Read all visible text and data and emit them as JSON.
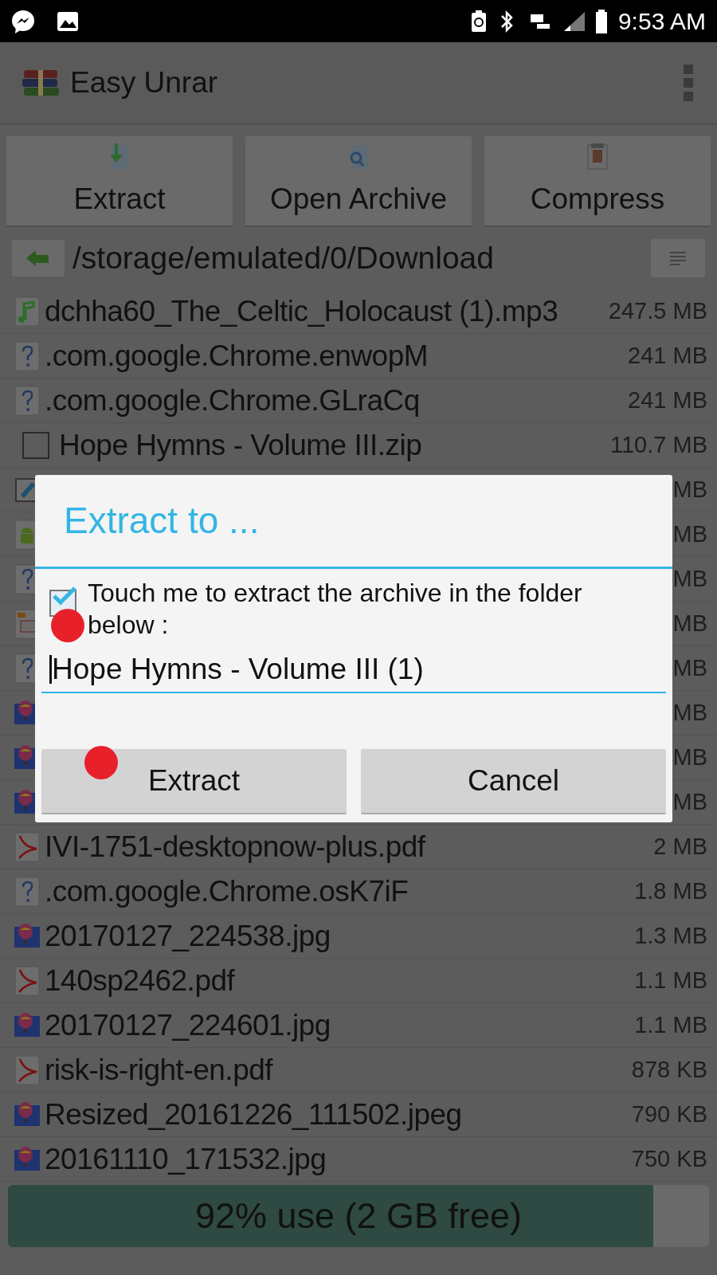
{
  "status_bar": {
    "time": "9:53 AM"
  },
  "app_bar": {
    "title": "Easy Unrar"
  },
  "toolbar": [
    {
      "label": "Extract",
      "kind": "extract"
    },
    {
      "label": "Open Archive",
      "kind": "open"
    },
    {
      "label": "Compress",
      "kind": "compress"
    }
  ],
  "path": "/storage/emulated/0/Download",
  "files": [
    {
      "kind": "audio",
      "name": "dchha60_The_Celtic_Holocaust (1).mp3",
      "size": "247.5 MB"
    },
    {
      "kind": "unknown",
      "name": ".com.google.Chrome.enwopM",
      "size": "241 MB"
    },
    {
      "kind": "unknown",
      "name": ".com.google.Chrome.GLraCq",
      "size": "241 MB"
    },
    {
      "kind": "archive",
      "name": "Hope Hymns - Volume III.zip",
      "size": "110.7 MB",
      "checked": false
    },
    {
      "kind": "edit",
      "size": "MB"
    },
    {
      "kind": "android",
      "size": "MB"
    },
    {
      "kind": "unknown",
      "size": "MB"
    },
    {
      "kind": "slides",
      "size": "MB"
    },
    {
      "kind": "unknown",
      "size": "MB"
    },
    {
      "kind": "image",
      "size": "MB"
    },
    {
      "kind": "image",
      "size": "MB"
    },
    {
      "kind": "image",
      "size": "MB"
    },
    {
      "kind": "pdf",
      "name": "IVI-1751-desktopnow-plus.pdf",
      "size": "2 MB"
    },
    {
      "kind": "unknown",
      "name": ".com.google.Chrome.osK7iF",
      "size": "1.8 MB"
    },
    {
      "kind": "image",
      "name": "20170127_224538.jpg",
      "size": "1.3 MB"
    },
    {
      "kind": "pdf",
      "name": "140sp2462.pdf",
      "size": "1.1 MB"
    },
    {
      "kind": "image",
      "name": "20170127_224601.jpg",
      "size": "1.1 MB"
    },
    {
      "kind": "pdf",
      "name": "risk-is-right-en.pdf",
      "size": "878 KB"
    },
    {
      "kind": "image",
      "name": "Resized_20161226_111502.jpeg",
      "size": "790 KB"
    },
    {
      "kind": "image",
      "name": "20161110_171532.jpg",
      "size": "750 KB"
    }
  ],
  "dialog": {
    "title": "Extract to ...",
    "checkbox": {
      "label": "Touch me to extract the archive in the folder below :",
      "checked": true
    },
    "field": {
      "value": "Hope Hymns - Volume III (1)"
    },
    "buttons": [
      "Extract",
      "Cancel"
    ]
  },
  "storage": {
    "label": "92% use (2 GB free)",
    "level": 0.92
  }
}
